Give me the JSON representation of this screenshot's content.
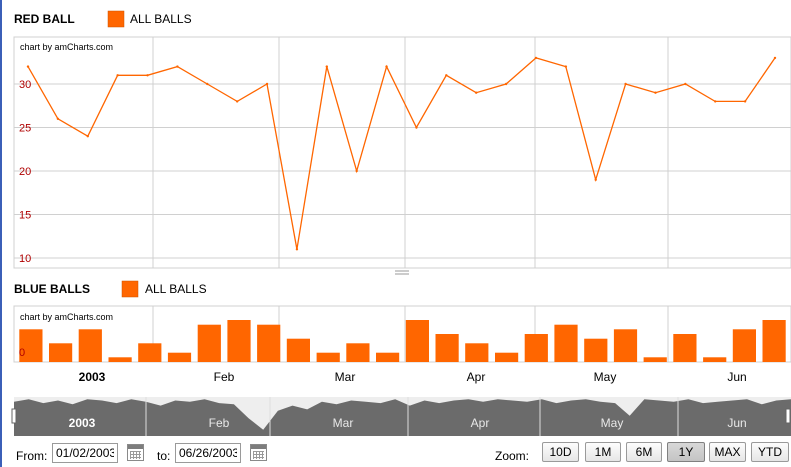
{
  "top_panel": {
    "title": "RED BALL",
    "legend_label": "ALL BALLS",
    "credit": "chart by amCharts.com"
  },
  "bottom_panel": {
    "title": "BLUE BALLS",
    "legend_label": "ALL BALLS",
    "credit": "chart by amCharts.com"
  },
  "controls": {
    "from_label": "From:",
    "from_value": "01/02/2003",
    "to_label": "to:",
    "to_value": "06/26/2003",
    "zoom_label": "Zoom:",
    "zoom_buttons": [
      "10D",
      "1M",
      "6M",
      "1Y",
      "MAX",
      "YTD"
    ],
    "active_zoom": "1Y"
  },
  "colors": {
    "series": "#ff6600",
    "tick": "#b00000",
    "scroller": "#6b6b6b",
    "grid": "#d0d0d0"
  },
  "chart_data": [
    {
      "type": "line",
      "title": "RED BALL",
      "series": [
        {
          "name": "ALL BALLS",
          "values": [
            32,
            26,
            24,
            31,
            31,
            32,
            30,
            28,
            30,
            11,
            32,
            20,
            32,
            25,
            31,
            29,
            30,
            33,
            32,
            19,
            30,
            29,
            30,
            28,
            28,
            33
          ]
        }
      ],
      "ylim": [
        10,
        35
      ],
      "yticks": [
        10,
        15,
        20,
        25,
        30
      ],
      "categories_axis": [
        "2003",
        "Feb",
        "Mar",
        "Apr",
        "May",
        "Jun"
      ],
      "grid": true
    },
    {
      "type": "bar",
      "title": "BLUE BALLS",
      "series": [
        {
          "name": "ALL BALLS",
          "values": [
            7,
            4,
            7,
            1,
            4,
            2,
            8,
            9,
            8,
            5,
            2,
            4,
            2,
            9,
            6,
            4,
            2,
            6,
            8,
            5,
            7,
            1,
            6,
            1,
            7,
            9
          ]
        }
      ],
      "ylim": [
        0,
        12
      ],
      "yticks": [
        0
      ],
      "categories_axis": [
        "2003",
        "Feb",
        "Mar",
        "Apr",
        "May",
        "Jun"
      ],
      "grid": true
    }
  ],
  "scroller": {
    "labels": [
      "2003",
      "Feb",
      "Mar",
      "Apr",
      "May",
      "Jun"
    ],
    "values": [
      27,
      29,
      26,
      28,
      25,
      29,
      28,
      26,
      29,
      27,
      24,
      28,
      27,
      29,
      26,
      25,
      14,
      5,
      20,
      24,
      21,
      27,
      25,
      28,
      27,
      26,
      29,
      24,
      28,
      26,
      28,
      29,
      27,
      29,
      28,
      27,
      29,
      26,
      28,
      29,
      27,
      26,
      16,
      29,
      28,
      27,
      29,
      26,
      27,
      28,
      29,
      25,
      28,
      29
    ]
  }
}
